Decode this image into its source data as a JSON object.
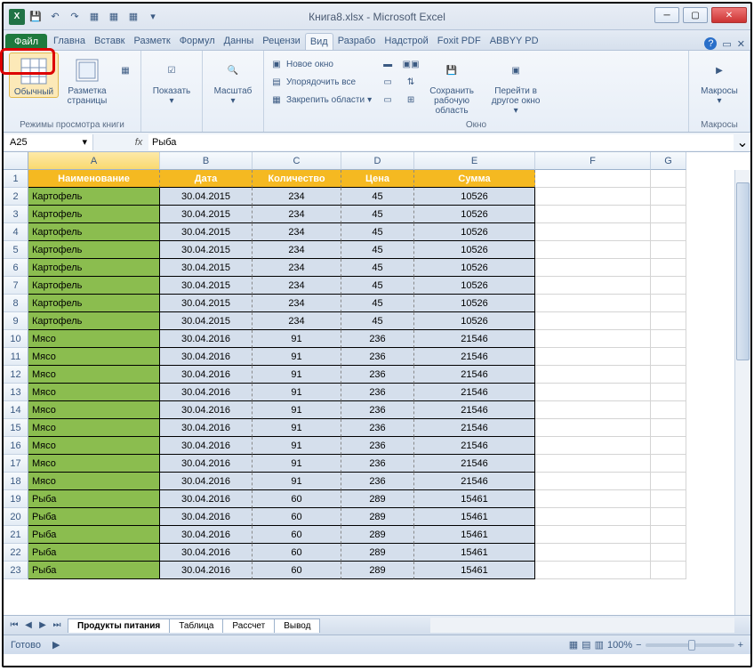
{
  "title": "Книга8.xlsx - Microsoft Excel",
  "qat": {
    "excel": "X"
  },
  "tabs": {
    "file": "Файл",
    "items": [
      "Главна",
      "Вставк",
      "Разметк",
      "Формул",
      "Данны",
      "Рецензи",
      "Вид",
      "Разрабо",
      "Надстрой",
      "Foxit PDF",
      "ABBYY PD"
    ],
    "active": "Вид"
  },
  "ribbon": {
    "g1": {
      "label": "Режимы просмотра книги",
      "normal": "Обычный",
      "layout": "Разметка страницы"
    },
    "g2": {
      "show": "Показать"
    },
    "g3": {
      "zoom": "Масштаб"
    },
    "g4": {
      "label": "Окно",
      "new": "Новое окно",
      "arrange": "Упорядочить все",
      "freeze": "Закрепить области",
      "save": "Сохранить рабочую область",
      "goto": "Перейти в другое окно"
    },
    "g5": {
      "label": "Макросы",
      "macros": "Макросы"
    }
  },
  "namebox": "A25",
  "formula": "Рыба",
  "columns": [
    "A",
    "B",
    "C",
    "D",
    "E",
    "F",
    "G"
  ],
  "headers": [
    "Наименование",
    "Дата",
    "Количество",
    "Цена",
    "Сумма"
  ],
  "rows": [
    {
      "n": "Картофель",
      "d": "30.04.2015",
      "q": "234",
      "p": "45",
      "s": "10526"
    },
    {
      "n": "Картофель",
      "d": "30.04.2015",
      "q": "234",
      "p": "45",
      "s": "10526"
    },
    {
      "n": "Картофель",
      "d": "30.04.2015",
      "q": "234",
      "p": "45",
      "s": "10526"
    },
    {
      "n": "Картофель",
      "d": "30.04.2015",
      "q": "234",
      "p": "45",
      "s": "10526"
    },
    {
      "n": "Картофель",
      "d": "30.04.2015",
      "q": "234",
      "p": "45",
      "s": "10526"
    },
    {
      "n": "Картофель",
      "d": "30.04.2015",
      "q": "234",
      "p": "45",
      "s": "10526"
    },
    {
      "n": "Картофель",
      "d": "30.04.2015",
      "q": "234",
      "p": "45",
      "s": "10526"
    },
    {
      "n": "Картофель",
      "d": "30.04.2015",
      "q": "234",
      "p": "45",
      "s": "10526"
    },
    {
      "n": "Мясо",
      "d": "30.04.2016",
      "q": "91",
      "p": "236",
      "s": "21546"
    },
    {
      "n": "Мясо",
      "d": "30.04.2016",
      "q": "91",
      "p": "236",
      "s": "21546"
    },
    {
      "n": "Мясо",
      "d": "30.04.2016",
      "q": "91",
      "p": "236",
      "s": "21546"
    },
    {
      "n": "Мясо",
      "d": "30.04.2016",
      "q": "91",
      "p": "236",
      "s": "21546"
    },
    {
      "n": "Мясо",
      "d": "30.04.2016",
      "q": "91",
      "p": "236",
      "s": "21546"
    },
    {
      "n": "Мясо",
      "d": "30.04.2016",
      "q": "91",
      "p": "236",
      "s": "21546"
    },
    {
      "n": "Мясо",
      "d": "30.04.2016",
      "q": "91",
      "p": "236",
      "s": "21546"
    },
    {
      "n": "Мясо",
      "d": "30.04.2016",
      "q": "91",
      "p": "236",
      "s": "21546"
    },
    {
      "n": "Мясо",
      "d": "30.04.2016",
      "q": "91",
      "p": "236",
      "s": "21546"
    },
    {
      "n": "Рыба",
      "d": "30.04.2016",
      "q": "60",
      "p": "289",
      "s": "15461"
    },
    {
      "n": "Рыба",
      "d": "30.04.2016",
      "q": "60",
      "p": "289",
      "s": "15461"
    },
    {
      "n": "Рыба",
      "d": "30.04.2016",
      "q": "60",
      "p": "289",
      "s": "15461"
    },
    {
      "n": "Рыба",
      "d": "30.04.2016",
      "q": "60",
      "p": "289",
      "s": "15461"
    },
    {
      "n": "Рыба",
      "d": "30.04.2016",
      "q": "60",
      "p": "289",
      "s": "15461"
    }
  ],
  "sheets": [
    "Продукты питания",
    "Таблица",
    "Рассчет",
    "Вывод"
  ],
  "status": {
    "ready": "Готово",
    "zoom": "100%"
  }
}
